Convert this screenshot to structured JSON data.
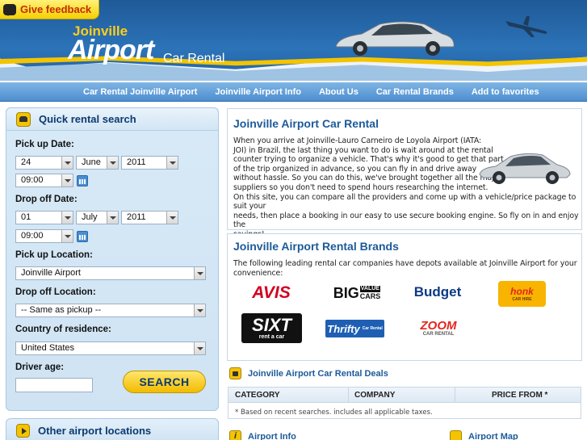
{
  "feedback": {
    "label": "Give feedback"
  },
  "logo": {
    "top": "Joinville",
    "main": "Airport",
    "sub": "Car Rental"
  },
  "nav": {
    "items": [
      {
        "label": "Car Rental Joinville Airport"
      },
      {
        "label": "Joinville Airport Info"
      },
      {
        "label": "About Us"
      },
      {
        "label": "Car Rental Brands"
      },
      {
        "label": "Add to favorites"
      }
    ]
  },
  "search": {
    "title": "Quick rental search",
    "pickup_date_label": "Pick up Date:",
    "pickup_day": "24",
    "pickup_month": "June",
    "pickup_year": "2011",
    "pickup_time": "09:00",
    "dropoff_date_label": "Drop off Date:",
    "dropoff_day": "01",
    "dropoff_month": "July",
    "dropoff_year": "2011",
    "dropoff_time": "09:00",
    "pickup_location_label": "Pick up Location:",
    "pickup_location": "Joinville Airport",
    "dropoff_location_label": "Drop off Location:",
    "dropoff_location": "-- Same as pickup --",
    "country_label": "Country of residence:",
    "country": "United States",
    "driver_age_label": "Driver age:",
    "driver_age": "",
    "button": "SEARCH"
  },
  "other_locations": {
    "title": "Other airport locations"
  },
  "intro": {
    "title": "Joinville Airport Car Rental",
    "lines": [
      "When you arrive at Joinville-Lauro Carneiro de Loyola Airport (IATA:",
      "JOI) in Brazil, the last thing you want to do is wait around at the rental",
      "counter trying to organize a vehicle. That's why it's good to get that part",
      "of the trip organized in advance, so you can fly in and drive away",
      "without hassle. So you can do this, we've brought together all the major",
      "suppliers so you don't need to spend hours researching the internet.",
      "On this site, you can compare all the providers and come up with a vehicle/price package to suit your",
      "needs, then place a booking in our easy to use secure booking engine. So fly on in and enjoy the",
      "savings!"
    ]
  },
  "brands": {
    "title": "Joinville Airport Rental Brands",
    "lines": [
      "The following leading rental car companies have depots available at Joinville Airport for your",
      "convenience:"
    ],
    "logos": {
      "avis": "AVIS",
      "big_main": "BIG",
      "big_sup1": "VALUE",
      "big_sup2": "CARS",
      "budget": "Budget",
      "honk_main": "honk",
      "honk_sub": "CAR HIRE",
      "sixt_main": "SIXT",
      "sixt_sub": "rent a car",
      "thrifty_main": "Thrifty",
      "thrifty_sub": "Car Rental",
      "zoom_main": "ZOOM",
      "zoom_sub": "CAR RENTAL"
    }
  },
  "deals": {
    "title": "Joinville Airport Car Rental Deals",
    "columns": [
      "CATEGORY",
      "COMPANY",
      "PRICE FROM *"
    ],
    "note": "* Based on recent searches. includes all applicable taxes."
  },
  "bottom": {
    "info": "Airport Info",
    "map": "Airport Map"
  },
  "colors": {
    "brand_blue": "#1c5a9a",
    "accent_yellow": "#f5c400",
    "nav_blue": "#4d8ed0"
  }
}
